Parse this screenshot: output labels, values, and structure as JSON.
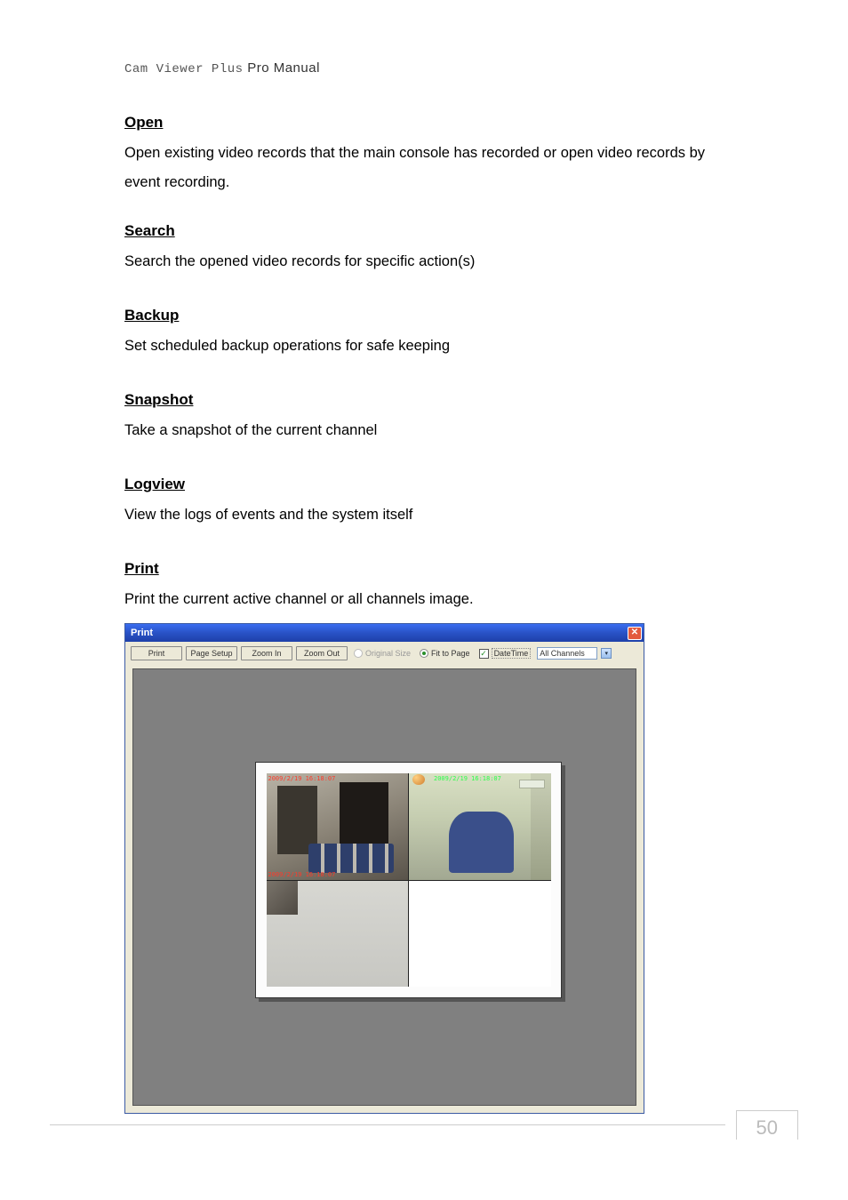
{
  "header": {
    "mono": "Cam Viewer Plus",
    "rest": " Pro Manual"
  },
  "sections": {
    "open": {
      "heading": "Open",
      "body": "Open existing video records that the main console has recorded or open video records by event recording."
    },
    "search": {
      "heading": "Search",
      "body": "Search the opened video records for specific action(s)"
    },
    "backup": {
      "heading": "Backup",
      "body": "Set scheduled backup operations for safe keeping"
    },
    "snapshot": {
      "heading": "Snapshot",
      "body": "Take a snapshot of the current channel"
    },
    "logview": {
      "heading": "Logview",
      "body": "View the logs of events and the system itself"
    },
    "print": {
      "heading": "Print",
      "body": "Print the current active channel or all channels image."
    }
  },
  "dialog": {
    "title": "Print",
    "close_glyph": "✕",
    "buttons": {
      "print": "Print",
      "page_setup": "Page Setup",
      "zoom_in": "Zoom In",
      "zoom_out": "Zoom Out"
    },
    "radios": {
      "original": "Original Size",
      "fit": "Fit to Page"
    },
    "checkbox": {
      "datetime": "DateTime",
      "check_glyph": "✓"
    },
    "combo": {
      "value": "All Channels",
      "arrow": "▾"
    },
    "overlay": {
      "cam1_ts_top": "2009/2/19 16:18:07",
      "cam1_ts_bottom": "2009/2/19 16:18:07",
      "cam2_ts": "2009/2/19 16:18:07"
    }
  },
  "footer": {
    "page": "50"
  }
}
